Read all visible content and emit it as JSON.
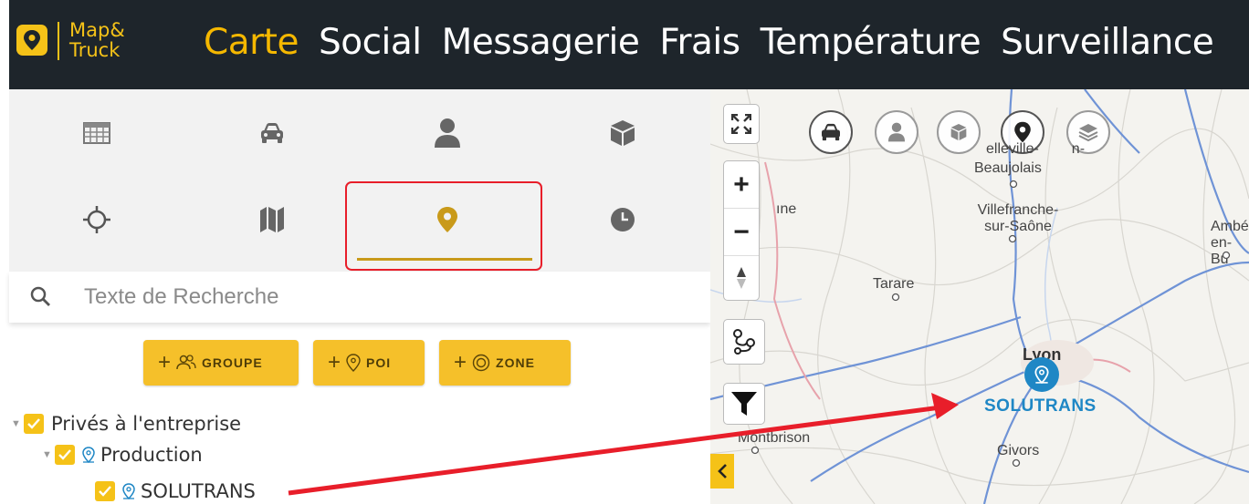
{
  "app": {
    "logo_text_line1": "Map&",
    "logo_text_line2": "Truck",
    "brand_color": "#f5c218"
  },
  "nav": {
    "items": [
      "Carte",
      "Social",
      "Messagerie",
      "Frais",
      "Température",
      "Surveillance"
    ],
    "active": "Carte"
  },
  "panel": {
    "tabs_row1": [
      "table-icon",
      "car-icon",
      "user-icon",
      "cube-icon"
    ],
    "tabs_row2": [
      "crosshair-icon",
      "map-icon",
      "pin-icon",
      "clock-icon"
    ],
    "active_tab": "pin-icon"
  },
  "search": {
    "placeholder": "Texte de Recherche",
    "value": ""
  },
  "buttons": {
    "group_label": "GROUPE",
    "poi_label": "POI",
    "zone_label": "ZONE",
    "plus": "+"
  },
  "tree": {
    "root_label": "Privés à l'entreprise",
    "group_label": "Production",
    "poi_label": "SOLUTRANS"
  },
  "map": {
    "cities": {
      "belleville_line1": "elleville-",
      "belleville_line1b": "n-",
      "belleville_line2": "Beaujolais",
      "villefranche_line1": "Villefranche-",
      "villefranche_line2": "sur-Saône",
      "tarare": "Tarare",
      "ambe_line1": "Ambé",
      "ambe_line2": "en-Bu",
      "une": "ıne",
      "lyon": "Lyon",
      "montbrison": "Montbrison",
      "givors": "Givors"
    },
    "poi_marker_label": "SOLUTRANS",
    "zoom_in": "+",
    "zoom_out": "−",
    "poi_color": "#1f87c5",
    "annotation_color": "#e81e2a"
  }
}
